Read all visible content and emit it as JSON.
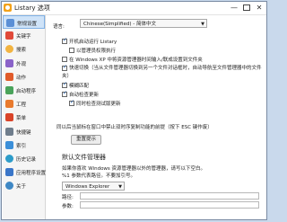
{
  "window": {
    "title": "Listary 选项"
  },
  "sidebar": {
    "items": [
      {
        "label": "常规设置",
        "icon": "gear-icon",
        "color": "#5b8fd6"
      },
      {
        "label": "关键字",
        "icon": "abc-icon",
        "color": "#e04a3a"
      },
      {
        "label": "搜索",
        "icon": "search-icon",
        "color": "#f2b441"
      },
      {
        "label": "外观",
        "icon": "palette-icon",
        "color": "#8a63c9"
      },
      {
        "label": "动作",
        "icon": "action-icon",
        "color": "#e05b2b"
      },
      {
        "label": "启动程序",
        "icon": "launch-icon",
        "color": "#4aa35b"
      },
      {
        "label": "工程",
        "icon": "project-icon",
        "color": "#e97b2f"
      },
      {
        "label": "菜单",
        "icon": "menu-icon",
        "color": "#d9442a"
      },
      {
        "label": "快捷键",
        "icon": "keyboard-icon",
        "color": "#6f7d8c"
      },
      {
        "label": "索引",
        "icon": "index-icon",
        "color": "#3b8fd9"
      },
      {
        "label": "历史记录",
        "icon": "history-icon",
        "color": "#2d9cc9"
      },
      {
        "label": "应用程序设置",
        "icon": "app-settings-icon",
        "color": "#3a76c9"
      },
      {
        "label": "关于",
        "icon": "info-icon",
        "color": "#3f88c5"
      }
    ]
  },
  "general": {
    "language_label": "语言:",
    "language_value": "Chinese(Simplified) - 简体中文",
    "options": [
      {
        "label": "开机启动运行 Listary",
        "checked": true
      },
      {
        "label": "以管理员权限执行",
        "checked": false
      },
      {
        "label": "在 Windows XP 中将资源管理器时间输入/联成设置到文件夹",
        "checked": false
      },
      {
        "label": "快速切换（当从文件管理器切换到另一个文件对话框时，自动导航至文件管理器中的文件夹）",
        "checked": true
      },
      {
        "label": "模糊匹配",
        "checked": true
      },
      {
        "label": "自动检查更新",
        "checked": true
      },
      {
        "label": "同时检查测试版更新",
        "checked": true
      }
    ],
    "disable_note": "同以后当鼠标在窗口中禁止双时序复制功能的前提（按下 ESC 键作废）",
    "reset_button": "重置提示",
    "file_manager": {
      "title": "默认文件管理器",
      "desc_line1": "如果你喜欢 Windows 资源管理器以外的管理器，请写以下空白。",
      "desc_line2": "%1 参数代表路径。不要加引号。",
      "explorer_value": "Windows Explorer",
      "path_label": "路径:",
      "params_label": "参数:"
    }
  }
}
